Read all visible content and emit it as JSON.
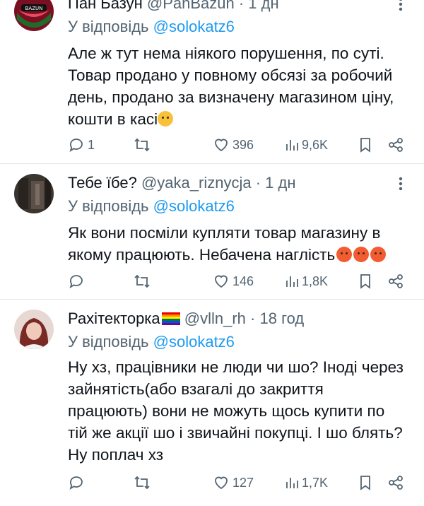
{
  "tweets": [
    {
      "name": "Пан Базун",
      "handle": "@PanBazun",
      "sep": "·",
      "time": "1 дн",
      "reply_prefix": "У відповідь ",
      "reply_to": "@solokatz6",
      "text_lines": [
        "Але ж тут нема ніякого порушення, по суті.",
        "Товар продано у повному обсязі за робочий",
        "день, продано за визначену магазином ціну,",
        "кошти в касі"
      ],
      "emoji": [
        "thinking-face"
      ],
      "replies": "1",
      "reposts": "",
      "likes": "396",
      "views": "9,6K"
    },
    {
      "name": "Тебе їбе?",
      "handle": "@yaka_riznycja",
      "sep": "·",
      "time": "1 дн",
      "reply_prefix": "У відповідь ",
      "reply_to": "@solokatz6",
      "text_lines": [
        "Як вони посміли купляти товар магазину в",
        "якому працюють. Небачена наглість"
      ],
      "emoji": [
        "angry-face",
        "angry-face",
        "angry-face"
      ],
      "replies": "",
      "reposts": "",
      "likes": "146",
      "views": "1,8K"
    },
    {
      "name": "Рахітекторка",
      "handle": "@vlln_rh",
      "sep": "·",
      "time": "18 год",
      "reply_prefix": "У відповідь ",
      "reply_to": "@solokatz6",
      "text_lines": [
        "Ну хз, працівники не люди чи шо? Іноді через",
        "зайнятість(або взагалі до закриття",
        "працюють) вони не можуть щось купити по",
        "тій же акції шо і звичайні покупці. І шо блять?",
        "Ну поплач хз"
      ],
      "emoji": [],
      "replies": "",
      "reposts": "",
      "likes": "127",
      "views": "1,7K"
    }
  ],
  "colors": {
    "text": "#0f1419",
    "muted": "#536471",
    "link": "#1d9bf0",
    "divider": "#e6e6e6"
  },
  "icons": [
    "reply-icon",
    "repost-icon",
    "like-icon",
    "views-icon",
    "bookmark-icon",
    "share-icon",
    "more-icon",
    "rainbow-flag-icon",
    "thinking-face-emoji",
    "angry-face-emoji"
  ]
}
